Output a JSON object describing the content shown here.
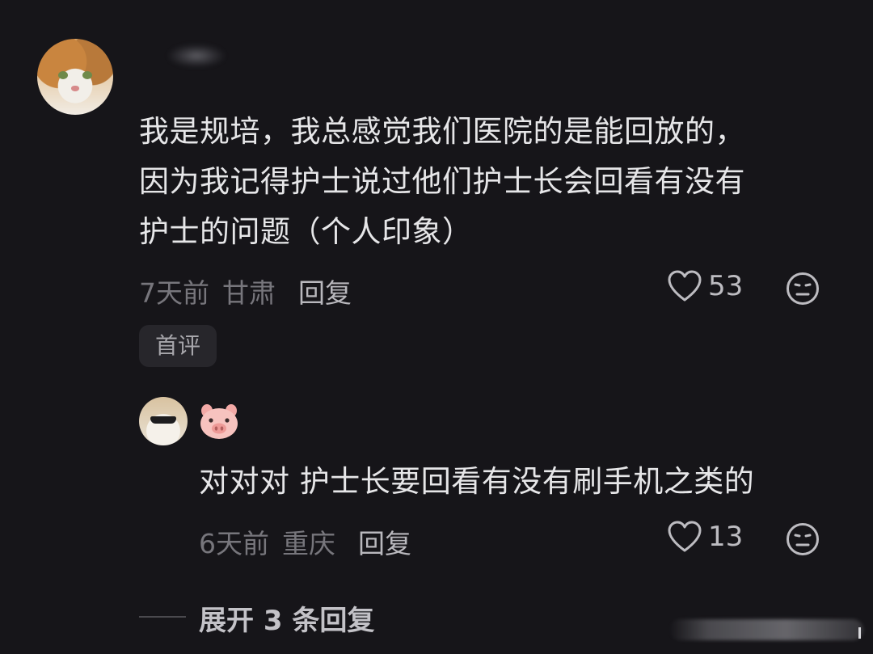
{
  "comment": {
    "text_line1": "我是规培，我总感觉我们医院的是能回放的，",
    "text_line2": "因为我记得护士说过他们护士长会回看有没有",
    "text_line3": "护士的问题（个人印象）",
    "time": "7天前",
    "location": "甘肃",
    "reply_label": "回复",
    "likes": "53",
    "badge": "首评"
  },
  "reply": {
    "username_emoji": "pig-face-icon",
    "text": "对对对 护士长要回看有没有刷手机之类的",
    "time": "6天前",
    "location": "重庆",
    "reply_label": "回复",
    "likes": "13"
  },
  "expand_label": "展开 3 条回复",
  "colors": {
    "background": "#161519",
    "text_primary": "#e6e6e8",
    "text_meta": "#77767c",
    "badge_bg": "#27262b"
  }
}
